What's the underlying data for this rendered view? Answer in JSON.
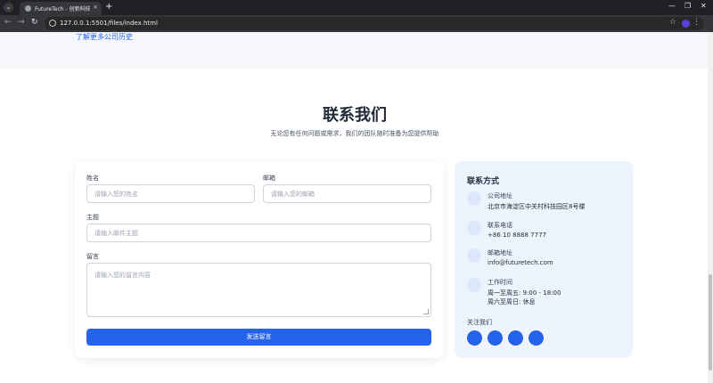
{
  "browser": {
    "tab_title": "FutureTech - 创新科技引领未来",
    "url": "127.0.0.1:5501/files/index.html",
    "icons": {
      "tab_menu": "chevron-down-icon",
      "close": "close-icon",
      "new_tab": "plus-icon",
      "back": "arrow-left-icon",
      "forward": "arrow-right-icon",
      "reload": "reload-icon",
      "star": "star-icon",
      "menu": "kebab-icon"
    },
    "glyphs": {
      "tab_menu": "⌄",
      "close": "×",
      "new_tab": "+",
      "back": "←",
      "forward": "→",
      "reload": "↻",
      "star": "☆",
      "kebab": "⋮",
      "minimize": "—",
      "maximize": "❐",
      "window_close": "✕"
    }
  },
  "top_section": {
    "history_link": "了解更多公司历史"
  },
  "contact": {
    "title": "联系我们",
    "subtitle": "无论您有任何问题或需求，我们的团队随时准备为您提供帮助",
    "form": {
      "name_label": "姓名",
      "name_placeholder": "请输入您的姓名",
      "email_label": "邮箱",
      "email_placeholder": "请输入您的邮箱",
      "subject_label": "主题",
      "subject_placeholder": "请输入邮件主题",
      "message_label": "留言",
      "message_placeholder": "请输入您的留言内容",
      "submit_label": "发送留言"
    },
    "info": {
      "title": "联系方式",
      "items": [
        {
          "label": "公司地址",
          "value": "北京市海淀区中关村科技园区8号楼",
          "value2": ""
        },
        {
          "label": "联系电话",
          "value": "+86 10 8888 7777",
          "value2": ""
        },
        {
          "label": "邮箱地址",
          "value": "info@futuretech.com",
          "value2": ""
        },
        {
          "label": "工作时间",
          "value": "周一至周五: 9:00 - 18:00",
          "value2": "周六至周日: 休息"
        }
      ],
      "follow_label": "关注我们"
    }
  },
  "colors": {
    "accent": "#2563eb",
    "info_card_bg": "#eef4fe"
  }
}
